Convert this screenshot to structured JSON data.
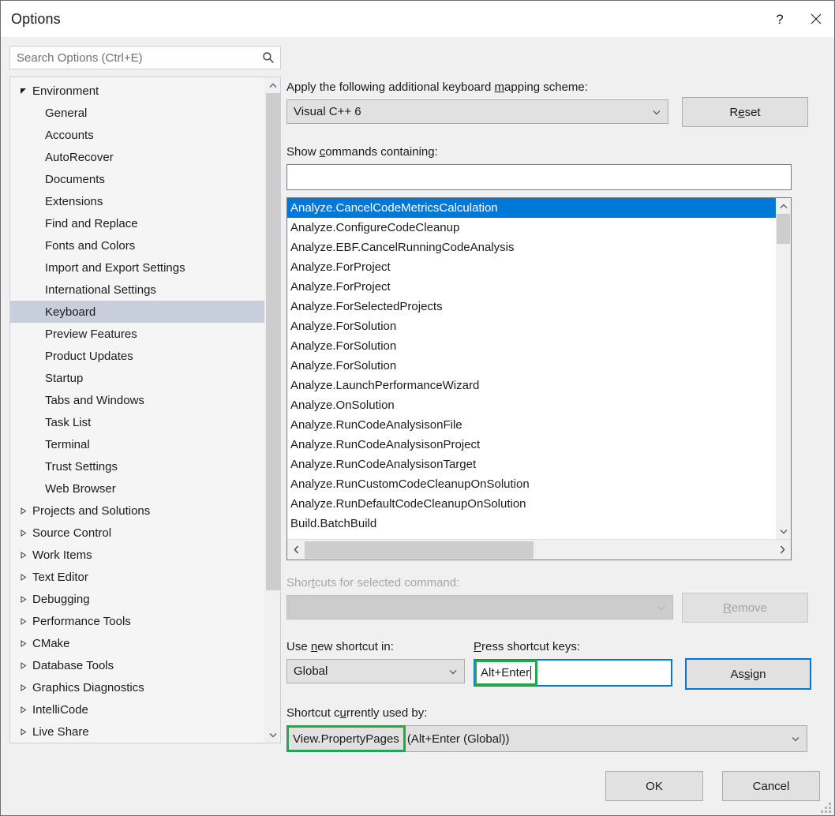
{
  "window": {
    "title": "Options",
    "help_icon": "question-mark-icon",
    "close_icon": "close-icon"
  },
  "search": {
    "placeholder": "Search Options (Ctrl+E)",
    "value": "",
    "icon": "search-icon"
  },
  "tree": {
    "items": [
      {
        "label": "Environment",
        "level": 0,
        "expander": "expanded",
        "selected": false
      },
      {
        "label": "General",
        "level": 1,
        "expander": "none",
        "selected": false
      },
      {
        "label": "Accounts",
        "level": 1,
        "expander": "none",
        "selected": false
      },
      {
        "label": "AutoRecover",
        "level": 1,
        "expander": "none",
        "selected": false
      },
      {
        "label": "Documents",
        "level": 1,
        "expander": "none",
        "selected": false
      },
      {
        "label": "Extensions",
        "level": 1,
        "expander": "none",
        "selected": false
      },
      {
        "label": "Find and Replace",
        "level": 1,
        "expander": "none",
        "selected": false
      },
      {
        "label": "Fonts and Colors",
        "level": 1,
        "expander": "none",
        "selected": false
      },
      {
        "label": "Import and Export Settings",
        "level": 1,
        "expander": "none",
        "selected": false
      },
      {
        "label": "International Settings",
        "level": 1,
        "expander": "none",
        "selected": false
      },
      {
        "label": "Keyboard",
        "level": 1,
        "expander": "none",
        "selected": true
      },
      {
        "label": "Preview Features",
        "level": 1,
        "expander": "none",
        "selected": false
      },
      {
        "label": "Product Updates",
        "level": 1,
        "expander": "none",
        "selected": false
      },
      {
        "label": "Startup",
        "level": 1,
        "expander": "none",
        "selected": false
      },
      {
        "label": "Tabs and Windows",
        "level": 1,
        "expander": "none",
        "selected": false
      },
      {
        "label": "Task List",
        "level": 1,
        "expander": "none",
        "selected": false
      },
      {
        "label": "Terminal",
        "level": 1,
        "expander": "none",
        "selected": false
      },
      {
        "label": "Trust Settings",
        "level": 1,
        "expander": "none",
        "selected": false
      },
      {
        "label": "Web Browser",
        "level": 1,
        "expander": "none",
        "selected": false
      },
      {
        "label": "Projects and Solutions",
        "level": 0,
        "expander": "collapsed",
        "selected": false
      },
      {
        "label": "Source Control",
        "level": 0,
        "expander": "collapsed",
        "selected": false
      },
      {
        "label": "Work Items",
        "level": 0,
        "expander": "collapsed",
        "selected": false
      },
      {
        "label": "Text Editor",
        "level": 0,
        "expander": "collapsed",
        "selected": false
      },
      {
        "label": "Debugging",
        "level": 0,
        "expander": "collapsed",
        "selected": false
      },
      {
        "label": "Performance Tools",
        "level": 0,
        "expander": "collapsed",
        "selected": false
      },
      {
        "label": "CMake",
        "level": 0,
        "expander": "collapsed",
        "selected": false
      },
      {
        "label": "Database Tools",
        "level": 0,
        "expander": "collapsed",
        "selected": false
      },
      {
        "label": "Graphics Diagnostics",
        "level": 0,
        "expander": "collapsed",
        "selected": false
      },
      {
        "label": "IntelliCode",
        "level": 0,
        "expander": "collapsed",
        "selected": false
      },
      {
        "label": "Live Share",
        "level": 0,
        "expander": "collapsed",
        "selected": false
      }
    ]
  },
  "panel": {
    "mapping_scheme_label_pre": "Apply the following additional keyboard ",
    "mapping_scheme_label_accel": "m",
    "mapping_scheme_label_post": "apping scheme:",
    "mapping_scheme_value": "Visual C++ 6",
    "reset_label_pre": "R",
    "reset_label_accel": "e",
    "reset_label_post": "set",
    "show_commands_label_pre": "Show ",
    "show_commands_label_accel": "c",
    "show_commands_label_post": "ommands containing:",
    "show_commands_value": "",
    "commands": [
      {
        "label": "Analyze.CancelCodeMetricsCalculation",
        "selected": true
      },
      {
        "label": "Analyze.ConfigureCodeCleanup",
        "selected": false
      },
      {
        "label": "Analyze.EBF.CancelRunningCodeAnalysis",
        "selected": false
      },
      {
        "label": "Analyze.ForProject",
        "selected": false
      },
      {
        "label": "Analyze.ForProject",
        "selected": false
      },
      {
        "label": "Analyze.ForSelectedProjects",
        "selected": false
      },
      {
        "label": "Analyze.ForSolution",
        "selected": false
      },
      {
        "label": "Analyze.ForSolution",
        "selected": false
      },
      {
        "label": "Analyze.ForSolution",
        "selected": false
      },
      {
        "label": "Analyze.LaunchPerformanceWizard",
        "selected": false
      },
      {
        "label": "Analyze.OnSolution",
        "selected": false
      },
      {
        "label": "Analyze.RunCodeAnalysisonFile",
        "selected": false
      },
      {
        "label": "Analyze.RunCodeAnalysisonProject",
        "selected": false
      },
      {
        "label": "Analyze.RunCodeAnalysisonTarget",
        "selected": false
      },
      {
        "label": "Analyze.RunCustomCodeCleanupOnSolution",
        "selected": false
      },
      {
        "label": "Analyze.RunDefaultCodeCleanupOnSolution",
        "selected": false
      },
      {
        "label": "Build.BatchBuild",
        "selected": false
      }
    ],
    "shortcuts_label_pre": "Shor",
    "shortcuts_label_accel": "t",
    "shortcuts_label_post": "cuts for selected command:",
    "shortcuts_value": "",
    "remove_label_pre": "",
    "remove_label_accel": "R",
    "remove_label_post": "emove",
    "use_new_shortcut_label_pre": "Use ",
    "use_new_shortcut_label_accel": "n",
    "use_new_shortcut_label_post": "ew shortcut in:",
    "use_new_shortcut_value": "Global",
    "press_shortcut_label_pre": "",
    "press_shortcut_label_accel": "P",
    "press_shortcut_label_post": "ress shortcut keys:",
    "press_shortcut_value": "Alt+Enter",
    "assign_label_pre": "As",
    "assign_label_accel": "s",
    "assign_label_post": "ign",
    "used_by_label_pre": "Shortcut c",
    "used_by_label_accel": "u",
    "used_by_label_post": "rrently used by:",
    "used_by_command": "View.PropertyPages",
    "used_by_detail": "(Alt+Enter (Global))"
  },
  "footer": {
    "ok_label": "OK",
    "cancel_label": "Cancel"
  },
  "colors": {
    "selection_blue": "#0078D7",
    "annotation_green": "#22A74A",
    "tree_selection": "#C9CEDC"
  }
}
